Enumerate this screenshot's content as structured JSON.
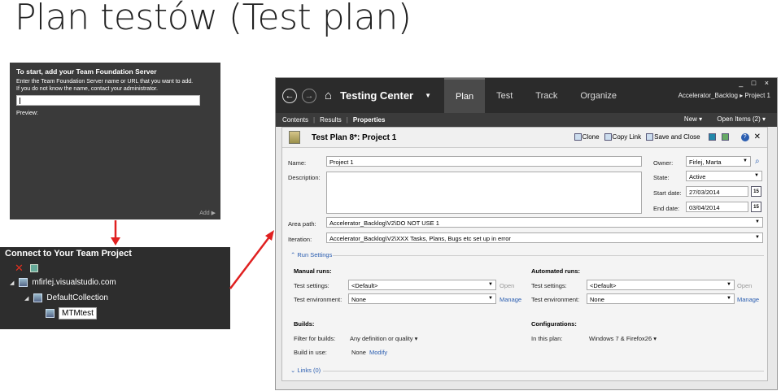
{
  "slide_title": "Plan testów (Test plan)",
  "tfs_dialog": {
    "heading": "To start, add your Team Foundation Server",
    "line1": "Enter the Team Foundation Server name or URL that you want to add.",
    "line2": "If you do not know the name, contact your administrator.",
    "preview_label": "Preview:",
    "add_label": "Add ▶"
  },
  "connect_panel": {
    "title": "Connect to Your Team Project",
    "server": "mfirlej.visualstudio.com",
    "collection": "DefaultCollection",
    "project": "MTMtest"
  },
  "mtm": {
    "app_title": "Testing Center",
    "tabs": [
      "Plan",
      "Test",
      "Track",
      "Organize"
    ],
    "active_tab": "Plan",
    "breadcrumb": "Accelerator_Backlog ▸ Project 1",
    "window_controls": "_ □ ×",
    "subtabs": [
      "Contents",
      "Results",
      "Properties"
    ],
    "new_label": "New ▾",
    "open_items_label": "Open Items (2) ▾",
    "plan_title": "Test Plan 8*: Project 1",
    "clone_label": "Clone",
    "copy_link_label": "Copy Link",
    "save_close_label": "Save and Close",
    "help_icon_text": "?",
    "close_icon_text": "✕",
    "name_label": "Name:",
    "name_value": "Project 1",
    "description_label": "Description:",
    "owner_label": "Owner:",
    "owner_value": "Firlej, Marta",
    "state_label": "State:",
    "state_value": "Active",
    "start_date_label": "Start date:",
    "start_date_value": "27/03/2014",
    "end_date_label": "End date:",
    "end_date_value": "03/04/2014",
    "calendar_icon_text": "15",
    "area_path_label": "Area path:",
    "area_path_value": "Accelerator_Backlog\\V2\\DO NOT USE 1",
    "iteration_label": "Iteration:",
    "iteration_value": "Accelerator_Backlog\\V2\\XXX Tasks, Plans, Bugs etc set up in error",
    "run_settings_label": "Run Settings",
    "manual_runs_label": "Manual runs:",
    "automated_runs_label": "Automated runs:",
    "test_settings_label": "Test settings:",
    "test_env_label": "Test environment:",
    "manual_test_settings": "<Default>",
    "manual_test_env": "None",
    "auto_test_settings": "<Default>",
    "auto_test_env": "None",
    "open_label": "Open",
    "manage_label": "Manage",
    "builds_label": "Builds:",
    "filter_builds_label": "Filter for builds:",
    "filter_builds_value": "Any definition or quality",
    "build_in_use_label": "Build in use:",
    "build_in_use_value": "None",
    "modify_label": "Modify",
    "configurations_label": "Configurations:",
    "in_this_plan_label": "In this plan:",
    "in_this_plan_value": "Windows 7 & Firefox26",
    "links_label": "Links (0)"
  },
  "colors": {
    "accent_red": "#e02020",
    "link_blue": "#2a5db0",
    "dark_bg": "#2b2b2b"
  }
}
